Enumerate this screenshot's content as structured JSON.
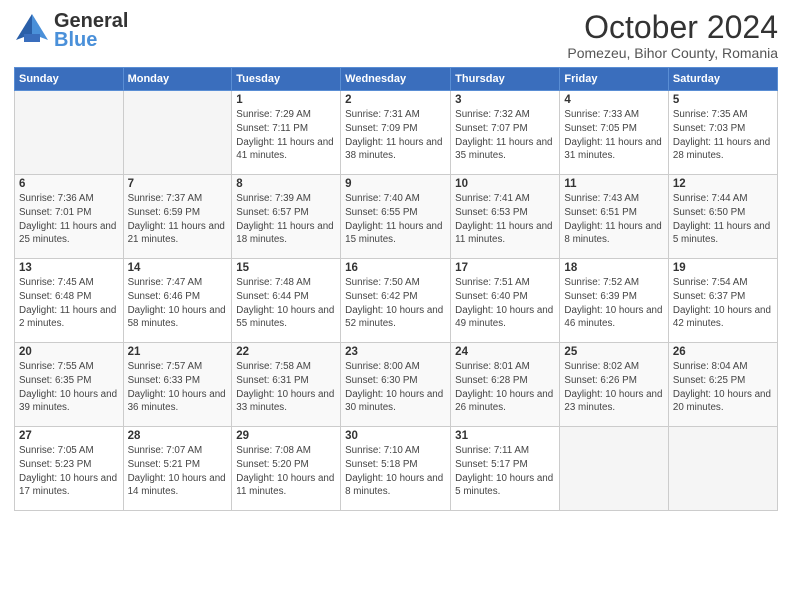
{
  "header": {
    "logo": {
      "line1": "General",
      "line2": "Blue"
    },
    "title": "October 2024",
    "subtitle": "Pomezeu, Bihor County, Romania"
  },
  "weekdays": [
    "Sunday",
    "Monday",
    "Tuesday",
    "Wednesday",
    "Thursday",
    "Friday",
    "Saturday"
  ],
  "weeks": [
    [
      {
        "day": "",
        "empty": true
      },
      {
        "day": "",
        "empty": true
      },
      {
        "day": "1",
        "sunrise": "Sunrise: 7:29 AM",
        "sunset": "Sunset: 7:11 PM",
        "daylight": "Daylight: 11 hours and 41 minutes."
      },
      {
        "day": "2",
        "sunrise": "Sunrise: 7:31 AM",
        "sunset": "Sunset: 7:09 PM",
        "daylight": "Daylight: 11 hours and 38 minutes."
      },
      {
        "day": "3",
        "sunrise": "Sunrise: 7:32 AM",
        "sunset": "Sunset: 7:07 PM",
        "daylight": "Daylight: 11 hours and 35 minutes."
      },
      {
        "day": "4",
        "sunrise": "Sunrise: 7:33 AM",
        "sunset": "Sunset: 7:05 PM",
        "daylight": "Daylight: 11 hours and 31 minutes."
      },
      {
        "day": "5",
        "sunrise": "Sunrise: 7:35 AM",
        "sunset": "Sunset: 7:03 PM",
        "daylight": "Daylight: 11 hours and 28 minutes."
      }
    ],
    [
      {
        "day": "6",
        "sunrise": "Sunrise: 7:36 AM",
        "sunset": "Sunset: 7:01 PM",
        "daylight": "Daylight: 11 hours and 25 minutes."
      },
      {
        "day": "7",
        "sunrise": "Sunrise: 7:37 AM",
        "sunset": "Sunset: 6:59 PM",
        "daylight": "Daylight: 11 hours and 21 minutes."
      },
      {
        "day": "8",
        "sunrise": "Sunrise: 7:39 AM",
        "sunset": "Sunset: 6:57 PM",
        "daylight": "Daylight: 11 hours and 18 minutes."
      },
      {
        "day": "9",
        "sunrise": "Sunrise: 7:40 AM",
        "sunset": "Sunset: 6:55 PM",
        "daylight": "Daylight: 11 hours and 15 minutes."
      },
      {
        "day": "10",
        "sunrise": "Sunrise: 7:41 AM",
        "sunset": "Sunset: 6:53 PM",
        "daylight": "Daylight: 11 hours and 11 minutes."
      },
      {
        "day": "11",
        "sunrise": "Sunrise: 7:43 AM",
        "sunset": "Sunset: 6:51 PM",
        "daylight": "Daylight: 11 hours and 8 minutes."
      },
      {
        "day": "12",
        "sunrise": "Sunrise: 7:44 AM",
        "sunset": "Sunset: 6:50 PM",
        "daylight": "Daylight: 11 hours and 5 minutes."
      }
    ],
    [
      {
        "day": "13",
        "sunrise": "Sunrise: 7:45 AM",
        "sunset": "Sunset: 6:48 PM",
        "daylight": "Daylight: 11 hours and 2 minutes."
      },
      {
        "day": "14",
        "sunrise": "Sunrise: 7:47 AM",
        "sunset": "Sunset: 6:46 PM",
        "daylight": "Daylight: 10 hours and 58 minutes."
      },
      {
        "day": "15",
        "sunrise": "Sunrise: 7:48 AM",
        "sunset": "Sunset: 6:44 PM",
        "daylight": "Daylight: 10 hours and 55 minutes."
      },
      {
        "day": "16",
        "sunrise": "Sunrise: 7:50 AM",
        "sunset": "Sunset: 6:42 PM",
        "daylight": "Daylight: 10 hours and 52 minutes."
      },
      {
        "day": "17",
        "sunrise": "Sunrise: 7:51 AM",
        "sunset": "Sunset: 6:40 PM",
        "daylight": "Daylight: 10 hours and 49 minutes."
      },
      {
        "day": "18",
        "sunrise": "Sunrise: 7:52 AM",
        "sunset": "Sunset: 6:39 PM",
        "daylight": "Daylight: 10 hours and 46 minutes."
      },
      {
        "day": "19",
        "sunrise": "Sunrise: 7:54 AM",
        "sunset": "Sunset: 6:37 PM",
        "daylight": "Daylight: 10 hours and 42 minutes."
      }
    ],
    [
      {
        "day": "20",
        "sunrise": "Sunrise: 7:55 AM",
        "sunset": "Sunset: 6:35 PM",
        "daylight": "Daylight: 10 hours and 39 minutes."
      },
      {
        "day": "21",
        "sunrise": "Sunrise: 7:57 AM",
        "sunset": "Sunset: 6:33 PM",
        "daylight": "Daylight: 10 hours and 36 minutes."
      },
      {
        "day": "22",
        "sunrise": "Sunrise: 7:58 AM",
        "sunset": "Sunset: 6:31 PM",
        "daylight": "Daylight: 10 hours and 33 minutes."
      },
      {
        "day": "23",
        "sunrise": "Sunrise: 8:00 AM",
        "sunset": "Sunset: 6:30 PM",
        "daylight": "Daylight: 10 hours and 30 minutes."
      },
      {
        "day": "24",
        "sunrise": "Sunrise: 8:01 AM",
        "sunset": "Sunset: 6:28 PM",
        "daylight": "Daylight: 10 hours and 26 minutes."
      },
      {
        "day": "25",
        "sunrise": "Sunrise: 8:02 AM",
        "sunset": "Sunset: 6:26 PM",
        "daylight": "Daylight: 10 hours and 23 minutes."
      },
      {
        "day": "26",
        "sunrise": "Sunrise: 8:04 AM",
        "sunset": "Sunset: 6:25 PM",
        "daylight": "Daylight: 10 hours and 20 minutes."
      }
    ],
    [
      {
        "day": "27",
        "sunrise": "Sunrise: 7:05 AM",
        "sunset": "Sunset: 5:23 PM",
        "daylight": "Daylight: 10 hours and 17 minutes."
      },
      {
        "day": "28",
        "sunrise": "Sunrise: 7:07 AM",
        "sunset": "Sunset: 5:21 PM",
        "daylight": "Daylight: 10 hours and 14 minutes."
      },
      {
        "day": "29",
        "sunrise": "Sunrise: 7:08 AM",
        "sunset": "Sunset: 5:20 PM",
        "daylight": "Daylight: 10 hours and 11 minutes."
      },
      {
        "day": "30",
        "sunrise": "Sunrise: 7:10 AM",
        "sunset": "Sunset: 5:18 PM",
        "daylight": "Daylight: 10 hours and 8 minutes."
      },
      {
        "day": "31",
        "sunrise": "Sunrise: 7:11 AM",
        "sunset": "Sunset: 5:17 PM",
        "daylight": "Daylight: 10 hours and 5 minutes."
      },
      {
        "day": "",
        "empty": true
      },
      {
        "day": "",
        "empty": true
      }
    ]
  ]
}
